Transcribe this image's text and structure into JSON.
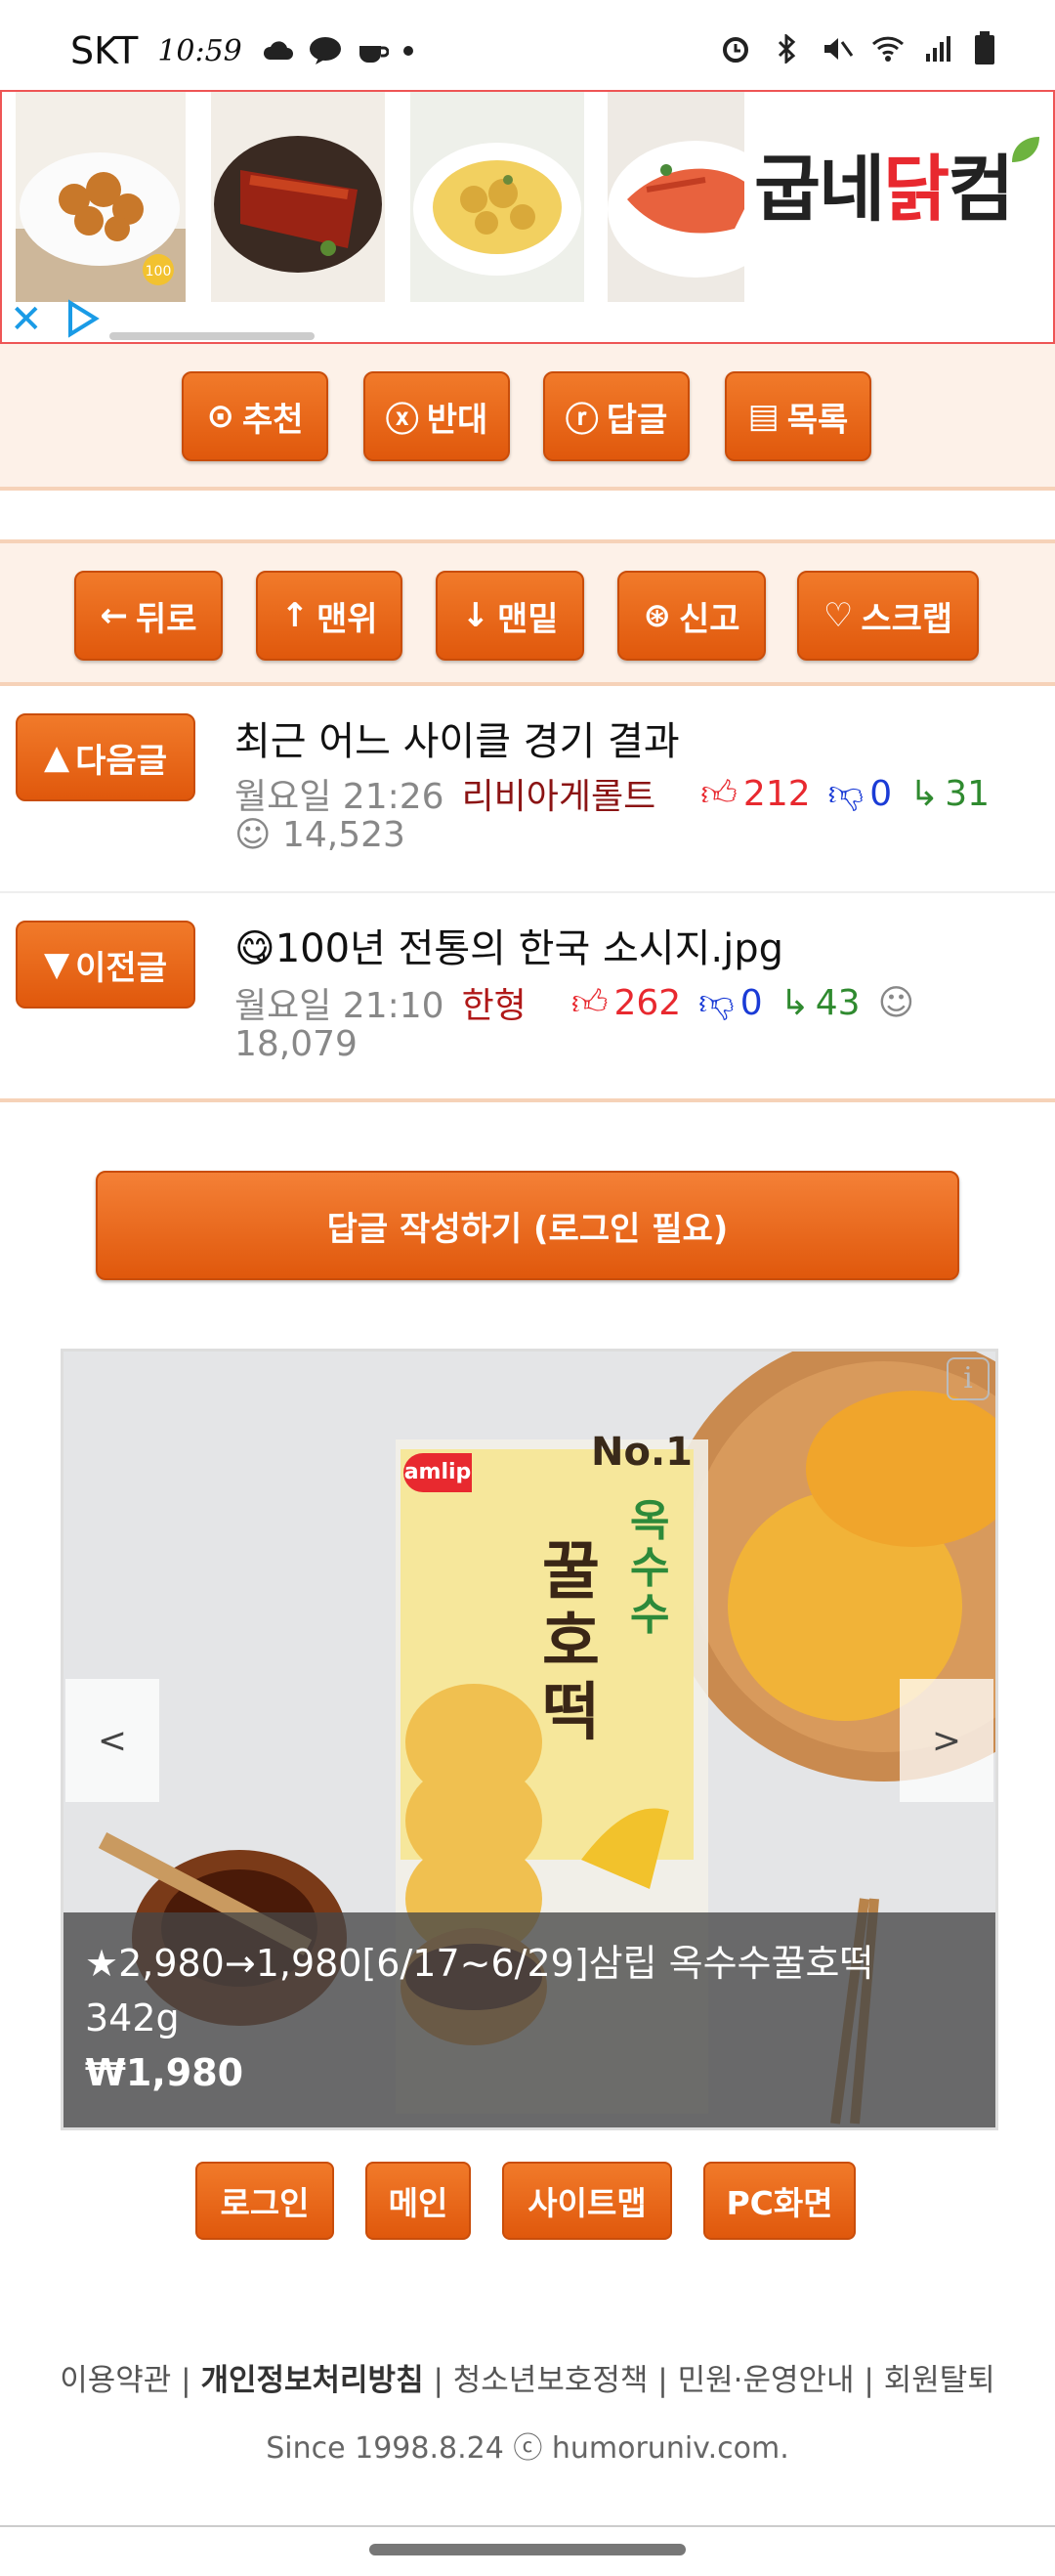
{
  "status": {
    "carrier": "SKT",
    "time": "10:59"
  },
  "ad": {
    "brand_prefix": "굽네",
    "brand_highlight": "닭",
    "brand_suffix": "컴",
    "badge": "100"
  },
  "post_actions": [
    {
      "label": "추천",
      "icon": "circle-dot-icon",
      "glyph": "⊙"
    },
    {
      "label": "반대",
      "icon": "circle-x-icon",
      "glyph": "ⓧ"
    },
    {
      "label": "답글",
      "icon": "circle-r-icon",
      "glyph": "ⓡ"
    },
    {
      "label": "목록",
      "icon": "list-icon",
      "glyph": "▤"
    }
  ],
  "nav_actions": [
    {
      "label": "뒤로",
      "icon": "arrow-left-icon",
      "glyph": "←"
    },
    {
      "label": "맨위",
      "icon": "arrow-up-icon",
      "glyph": "↑"
    },
    {
      "label": "맨밑",
      "icon": "arrow-down-icon",
      "glyph": "↓"
    },
    {
      "label": "신고",
      "icon": "report-icon",
      "glyph": "⊛"
    },
    {
      "label": "스크랩",
      "icon": "heart-icon",
      "glyph": "♡"
    }
  ],
  "next_post": {
    "button": "다음글",
    "title": "최근 어느 사이클 경기 결과",
    "time": "월요일 21:26",
    "author": "리비아게롤트",
    "up": "212",
    "down": "0",
    "replies": "31",
    "views": "14,523"
  },
  "prev_post": {
    "button": "이전글",
    "title": "100년 전통의 한국 소시지.jpg",
    "time": "월요일 21:10",
    "author": "한형",
    "up": "262",
    "down": "0",
    "replies": "43",
    "views": "18,079"
  },
  "write_reply": "답글 작성하기 (로그인 필요)",
  "product": {
    "title": "★2,980→1,980[6/17~6/29]삼립 옥수수꿀호떡 342g",
    "price": "₩1,980",
    "package_brand": "amlip",
    "package_badge": "No.1",
    "package_name_small": "옥수수",
    "package_name_big": "꿀호떡",
    "prev_arrow": "<",
    "next_arrow": ">",
    "info": "i"
  },
  "footer_buttons": [
    "로그인",
    "메인",
    "사이트맵",
    "PC화면"
  ],
  "footer_links": {
    "terms": "이용약관",
    "privacy": "개인정보처리방침",
    "youth": "청소년보호정책",
    "guide": "민원·운영안내",
    "withdraw": "회원탈퇴"
  },
  "since": "Since 1998.8.24 ⓒ humoruniv.com."
}
